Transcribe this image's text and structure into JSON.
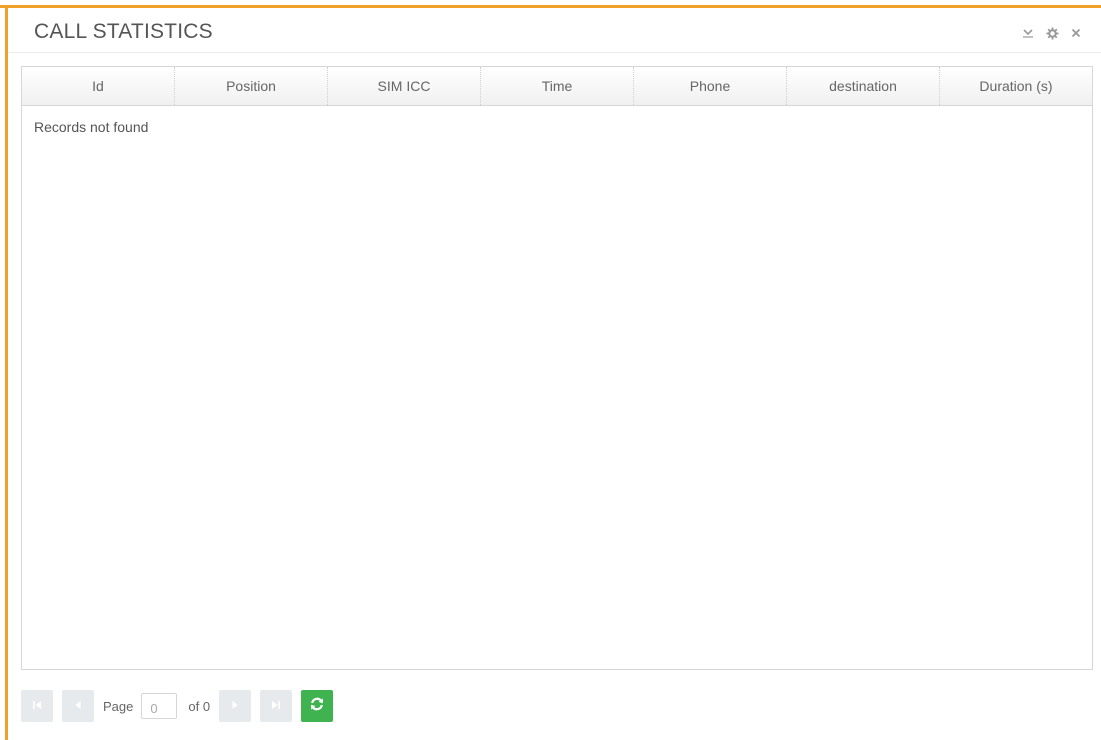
{
  "panel": {
    "title": "CALL STATISTICS",
    "accent_color": "#f0a028",
    "window_icons": [
      "chevron-down-icon",
      "gear-icon",
      "close-icon"
    ]
  },
  "grid": {
    "columns": [
      "Id",
      "Position",
      "SIM ICC",
      "Time",
      "Phone",
      "destination",
      "Duration (s)"
    ],
    "empty_message": "Records not found"
  },
  "pager": {
    "page_label": "Page",
    "page_value": "0",
    "of_label": "of 0",
    "buttons": [
      "first-page-icon",
      "prev-page-icon",
      "next-page-icon",
      "last-page-icon",
      "refresh-icon"
    ],
    "refresh_color": "#3fb34f"
  }
}
